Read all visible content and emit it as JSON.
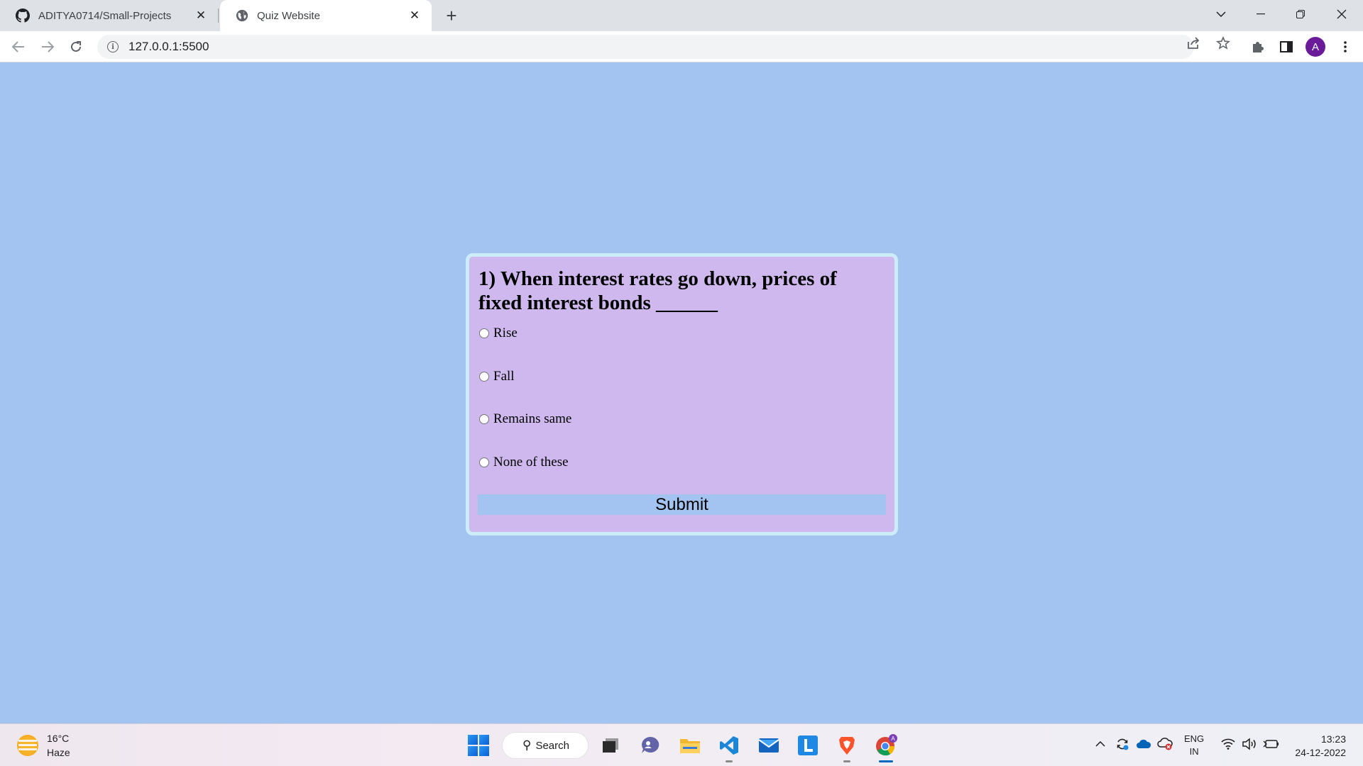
{
  "browser": {
    "tabs": [
      {
        "title": "ADITYA0714/Small-Projects",
        "icon": "github-icon",
        "active": false
      },
      {
        "title": "Quiz Website",
        "icon": "globe-icon",
        "active": true
      }
    ],
    "new_tab_label": "+",
    "url": "127.0.0.1:5500",
    "profile_initial": "A",
    "profile_color": "#6a1b9a"
  },
  "quiz": {
    "question": "1) When interest rates go down, prices of fixed interest bonds ______",
    "options": [
      {
        "label": "Rise",
        "checked": false
      },
      {
        "label": "Fall",
        "checked": false
      },
      {
        "label": "Remains same",
        "checked": false
      },
      {
        "label": "None of these",
        "checked": false
      }
    ],
    "submit_label": "Submit"
  },
  "colors": {
    "page_background": "#a3c3f0",
    "card_background": "#cfb8ee",
    "card_border": "#ccecfc",
    "button_background": "#a3c3f0"
  },
  "taskbar": {
    "weather": {
      "temperature": "16°C",
      "condition": "Haze"
    },
    "search_label": "Search",
    "apps": [
      "start-icon",
      "task-view-icon",
      "chat-icon",
      "file-explorer-icon",
      "vscode-icon",
      "mail-icon",
      "l-app-icon",
      "brave-icon",
      "chrome-icon"
    ],
    "language": {
      "line1": "ENG",
      "line2": "IN"
    },
    "clock": {
      "time": "13:23",
      "date": "24-12-2022"
    }
  }
}
